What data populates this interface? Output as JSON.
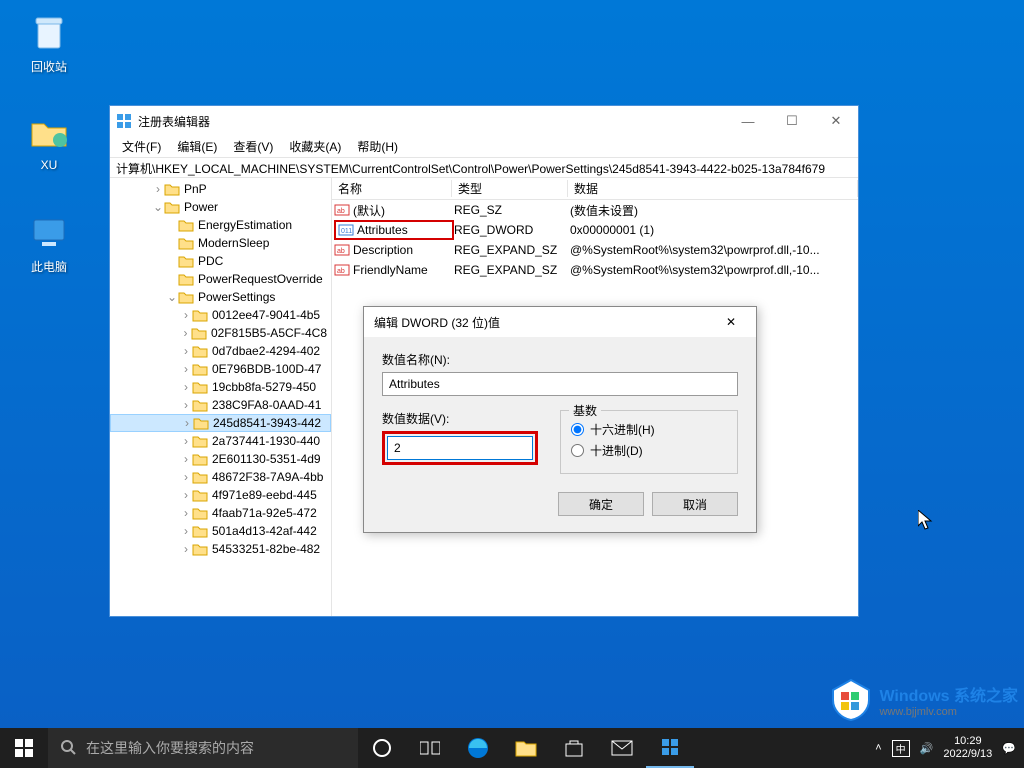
{
  "desktop": {
    "icons": [
      {
        "name": "recycle-bin",
        "label": "回收站"
      },
      {
        "name": "xu-folder",
        "label": "XU"
      },
      {
        "name": "this-pc",
        "label": "此电脑"
      }
    ]
  },
  "regedit": {
    "title": "注册表编辑器",
    "menu": {
      "file": "文件(F)",
      "edit": "编辑(E)",
      "view": "查看(V)",
      "favorites": "收藏夹(A)",
      "help": "帮助(H)"
    },
    "address": "计算机\\HKEY_LOCAL_MACHINE\\SYSTEM\\CurrentControlSet\\Control\\Power\\PowerSettings\\245d8541-3943-4422-b025-13a784f679",
    "tree": [
      {
        "indent": 3,
        "tw": ">",
        "label": "PnP"
      },
      {
        "indent": 3,
        "tw": "v",
        "label": "Power"
      },
      {
        "indent": 4,
        "tw": "",
        "label": "EnergyEstimation"
      },
      {
        "indent": 4,
        "tw": "",
        "label": "ModernSleep"
      },
      {
        "indent": 4,
        "tw": "",
        "label": "PDC"
      },
      {
        "indent": 4,
        "tw": "",
        "label": "PowerRequestOverride"
      },
      {
        "indent": 4,
        "tw": "v",
        "label": "PowerSettings"
      },
      {
        "indent": 5,
        "tw": ">",
        "label": "0012ee47-9041-4b5"
      },
      {
        "indent": 5,
        "tw": ">",
        "label": "02F815B5-A5CF-4C8"
      },
      {
        "indent": 5,
        "tw": ">",
        "label": "0d7dbae2-4294-402"
      },
      {
        "indent": 5,
        "tw": ">",
        "label": "0E796BDB-100D-47"
      },
      {
        "indent": 5,
        "tw": ">",
        "label": "19cbb8fa-5279-450"
      },
      {
        "indent": 5,
        "tw": ">",
        "label": "238C9FA8-0AAD-41"
      },
      {
        "indent": 5,
        "tw": ">",
        "label": "245d8541-3943-442",
        "selected": true
      },
      {
        "indent": 5,
        "tw": ">",
        "label": "2a737441-1930-440"
      },
      {
        "indent": 5,
        "tw": ">",
        "label": "2E601130-5351-4d9"
      },
      {
        "indent": 5,
        "tw": ">",
        "label": "48672F38-7A9A-4bb"
      },
      {
        "indent": 5,
        "tw": ">",
        "label": "4f971e89-eebd-445"
      },
      {
        "indent": 5,
        "tw": ">",
        "label": "4faab71a-92e5-472"
      },
      {
        "indent": 5,
        "tw": ">",
        "label": "501a4d13-42af-442"
      },
      {
        "indent": 5,
        "tw": ">",
        "label": "54533251-82be-482"
      }
    ],
    "list": {
      "cols": {
        "name": "名称",
        "type": "类型",
        "data": "数据"
      },
      "rows": [
        {
          "ico": "sz",
          "name": "(默认)",
          "type": "REG_SZ",
          "data": "(数值未设置)"
        },
        {
          "ico": "dw",
          "name": "Attributes",
          "type": "REG_DWORD",
          "data": "0x00000001 (1)",
          "selected": true
        },
        {
          "ico": "sz",
          "name": "Description",
          "type": "REG_EXPAND_SZ",
          "data": "@%SystemRoot%\\system32\\powrprof.dll,-10..."
        },
        {
          "ico": "sz",
          "name": "FriendlyName",
          "type": "REG_EXPAND_SZ",
          "data": "@%SystemRoot%\\system32\\powrprof.dll,-10..."
        }
      ]
    }
  },
  "dialog": {
    "title": "编辑 DWORD (32 位)值",
    "name_label": "数值名称(N):",
    "name_value": "Attributes",
    "data_label": "数值数据(V):",
    "data_value": "2",
    "base_label": "基数",
    "hex": "十六进制(H)",
    "dec": "十进制(D)",
    "ok": "确定",
    "cancel": "取消"
  },
  "taskbar": {
    "search_placeholder": "在这里输入你要搜索的内容",
    "time": "10:29",
    "date": "2022/9/13"
  },
  "watermark": {
    "line1": "Windows 系统之家",
    "line2": "www.bjjmlv.com"
  }
}
